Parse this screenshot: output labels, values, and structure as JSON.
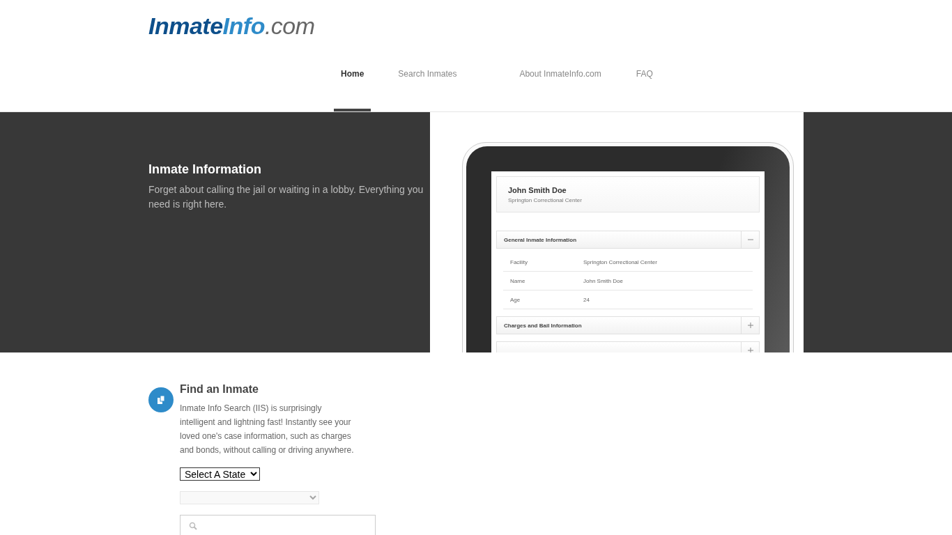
{
  "logo": {
    "parts": [
      {
        "text": "Inmate",
        "kind": "dark"
      },
      {
        "text": "Info",
        "kind": "light"
      },
      {
        "text": ".com",
        "kind": "domain"
      }
    ]
  },
  "nav": [
    {
      "label": "Home",
      "selected": true
    },
    {
      "label": "Search Inmates",
      "selected": false
    },
    {
      "label": "About InmateInfo.com",
      "selected": false
    },
    {
      "label": "FAQ",
      "selected": false
    }
  ],
  "hero": {
    "title": "Inmate Information",
    "text": "Forget about calling the jail or waiting in a lobby. Everything you need is right here.",
    "record": {
      "name": "John Smith Doe",
      "facility": "Springton Correctional Center",
      "sections": [
        {
          "title": "General Inmate Information",
          "expanded": true,
          "rows": [
            {
              "label": "Facility",
              "value": "Springton Correctional Center"
            },
            {
              "label": "Name",
              "value": "John Smith Doe"
            },
            {
              "label": "Age",
              "value": "24"
            }
          ]
        },
        {
          "title": "Charges and Bail Information",
          "expanded": false
        },
        {
          "expanded": false
        }
      ]
    }
  },
  "find": {
    "title": "Find an Inmate",
    "text": "Inmate Info Search (IIS) is surprisingly intelligent and lightning fast! Instantly see your loved one's case information, such as charges and bonds, without calling or driving anywhere.",
    "state_select": {
      "value": "Select A State"
    },
    "facility_select": {
      "disabled": true
    }
  }
}
